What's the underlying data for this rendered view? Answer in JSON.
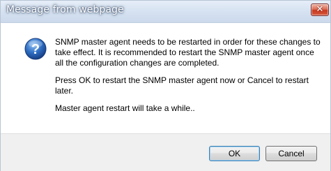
{
  "window": {
    "title": "Message from webpage",
    "close_glyph": "✕"
  },
  "message": {
    "paragraphs": [
      "SNMP master agent needs to be restarted in order for these changes to take effect. It is recommended to restart the SNMP master agent once all the configuration changes are completed.",
      "Press OK to restart the SNMP master agent now or Cancel to restart later.",
      "Master agent restart will take a while.."
    ]
  },
  "icon": {
    "name": "question-icon",
    "glyph": "?",
    "color": "#2a5da8"
  },
  "buttons": {
    "ok_label": "OK",
    "cancel_label": "Cancel"
  }
}
